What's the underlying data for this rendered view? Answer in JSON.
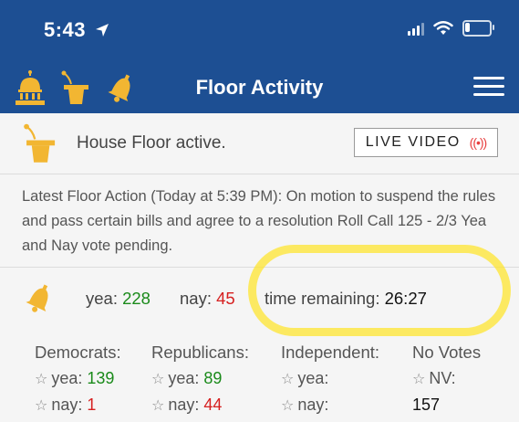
{
  "status_bar": {
    "time": "5:43",
    "location_glyph": "➤"
  },
  "nav": {
    "title": "Floor Activity",
    "icons": [
      "capitol-icon",
      "podium-icon",
      "bell-icon",
      "menu-icon"
    ]
  },
  "floor": {
    "status_text": "House Floor active.",
    "live_label": "LIVE VIDEO",
    "live_glyph": "((•))"
  },
  "latest_action": {
    "text": "Latest Floor Action (Today at 5:39 PM): On motion to suspend the rules and pass certain bills and agree to a resolution Roll Call 125 - 2/3 Yea and Nay vote pending."
  },
  "vote": {
    "yea_label": "yea:",
    "yea_value": "228",
    "nay_label": "nay:",
    "nay_value": "45",
    "time_label": "time remaining:",
    "time_value": "26:27"
  },
  "parties": {
    "democrats": {
      "header": "Democrats:",
      "yea_label": "yea:",
      "yea": "139",
      "nay_label": "nay:",
      "nay": "1"
    },
    "republicans": {
      "header": "Republicans:",
      "yea_label": "yea:",
      "yea": "89",
      "nay_label": "nay:",
      "nay": "44"
    },
    "independent": {
      "header": "Independent:",
      "yea_label": "yea:",
      "nay_label": "nay:"
    },
    "no_votes": {
      "header": "No Votes",
      "nv_label": "NV:",
      "nv": "157"
    }
  },
  "colors": {
    "header_bg": "#1d4f93",
    "icon_gold": "#f2b632",
    "yea_green": "#1a8a1a",
    "nay_red": "#d62020",
    "highlight_yellow": "#ffe428"
  }
}
